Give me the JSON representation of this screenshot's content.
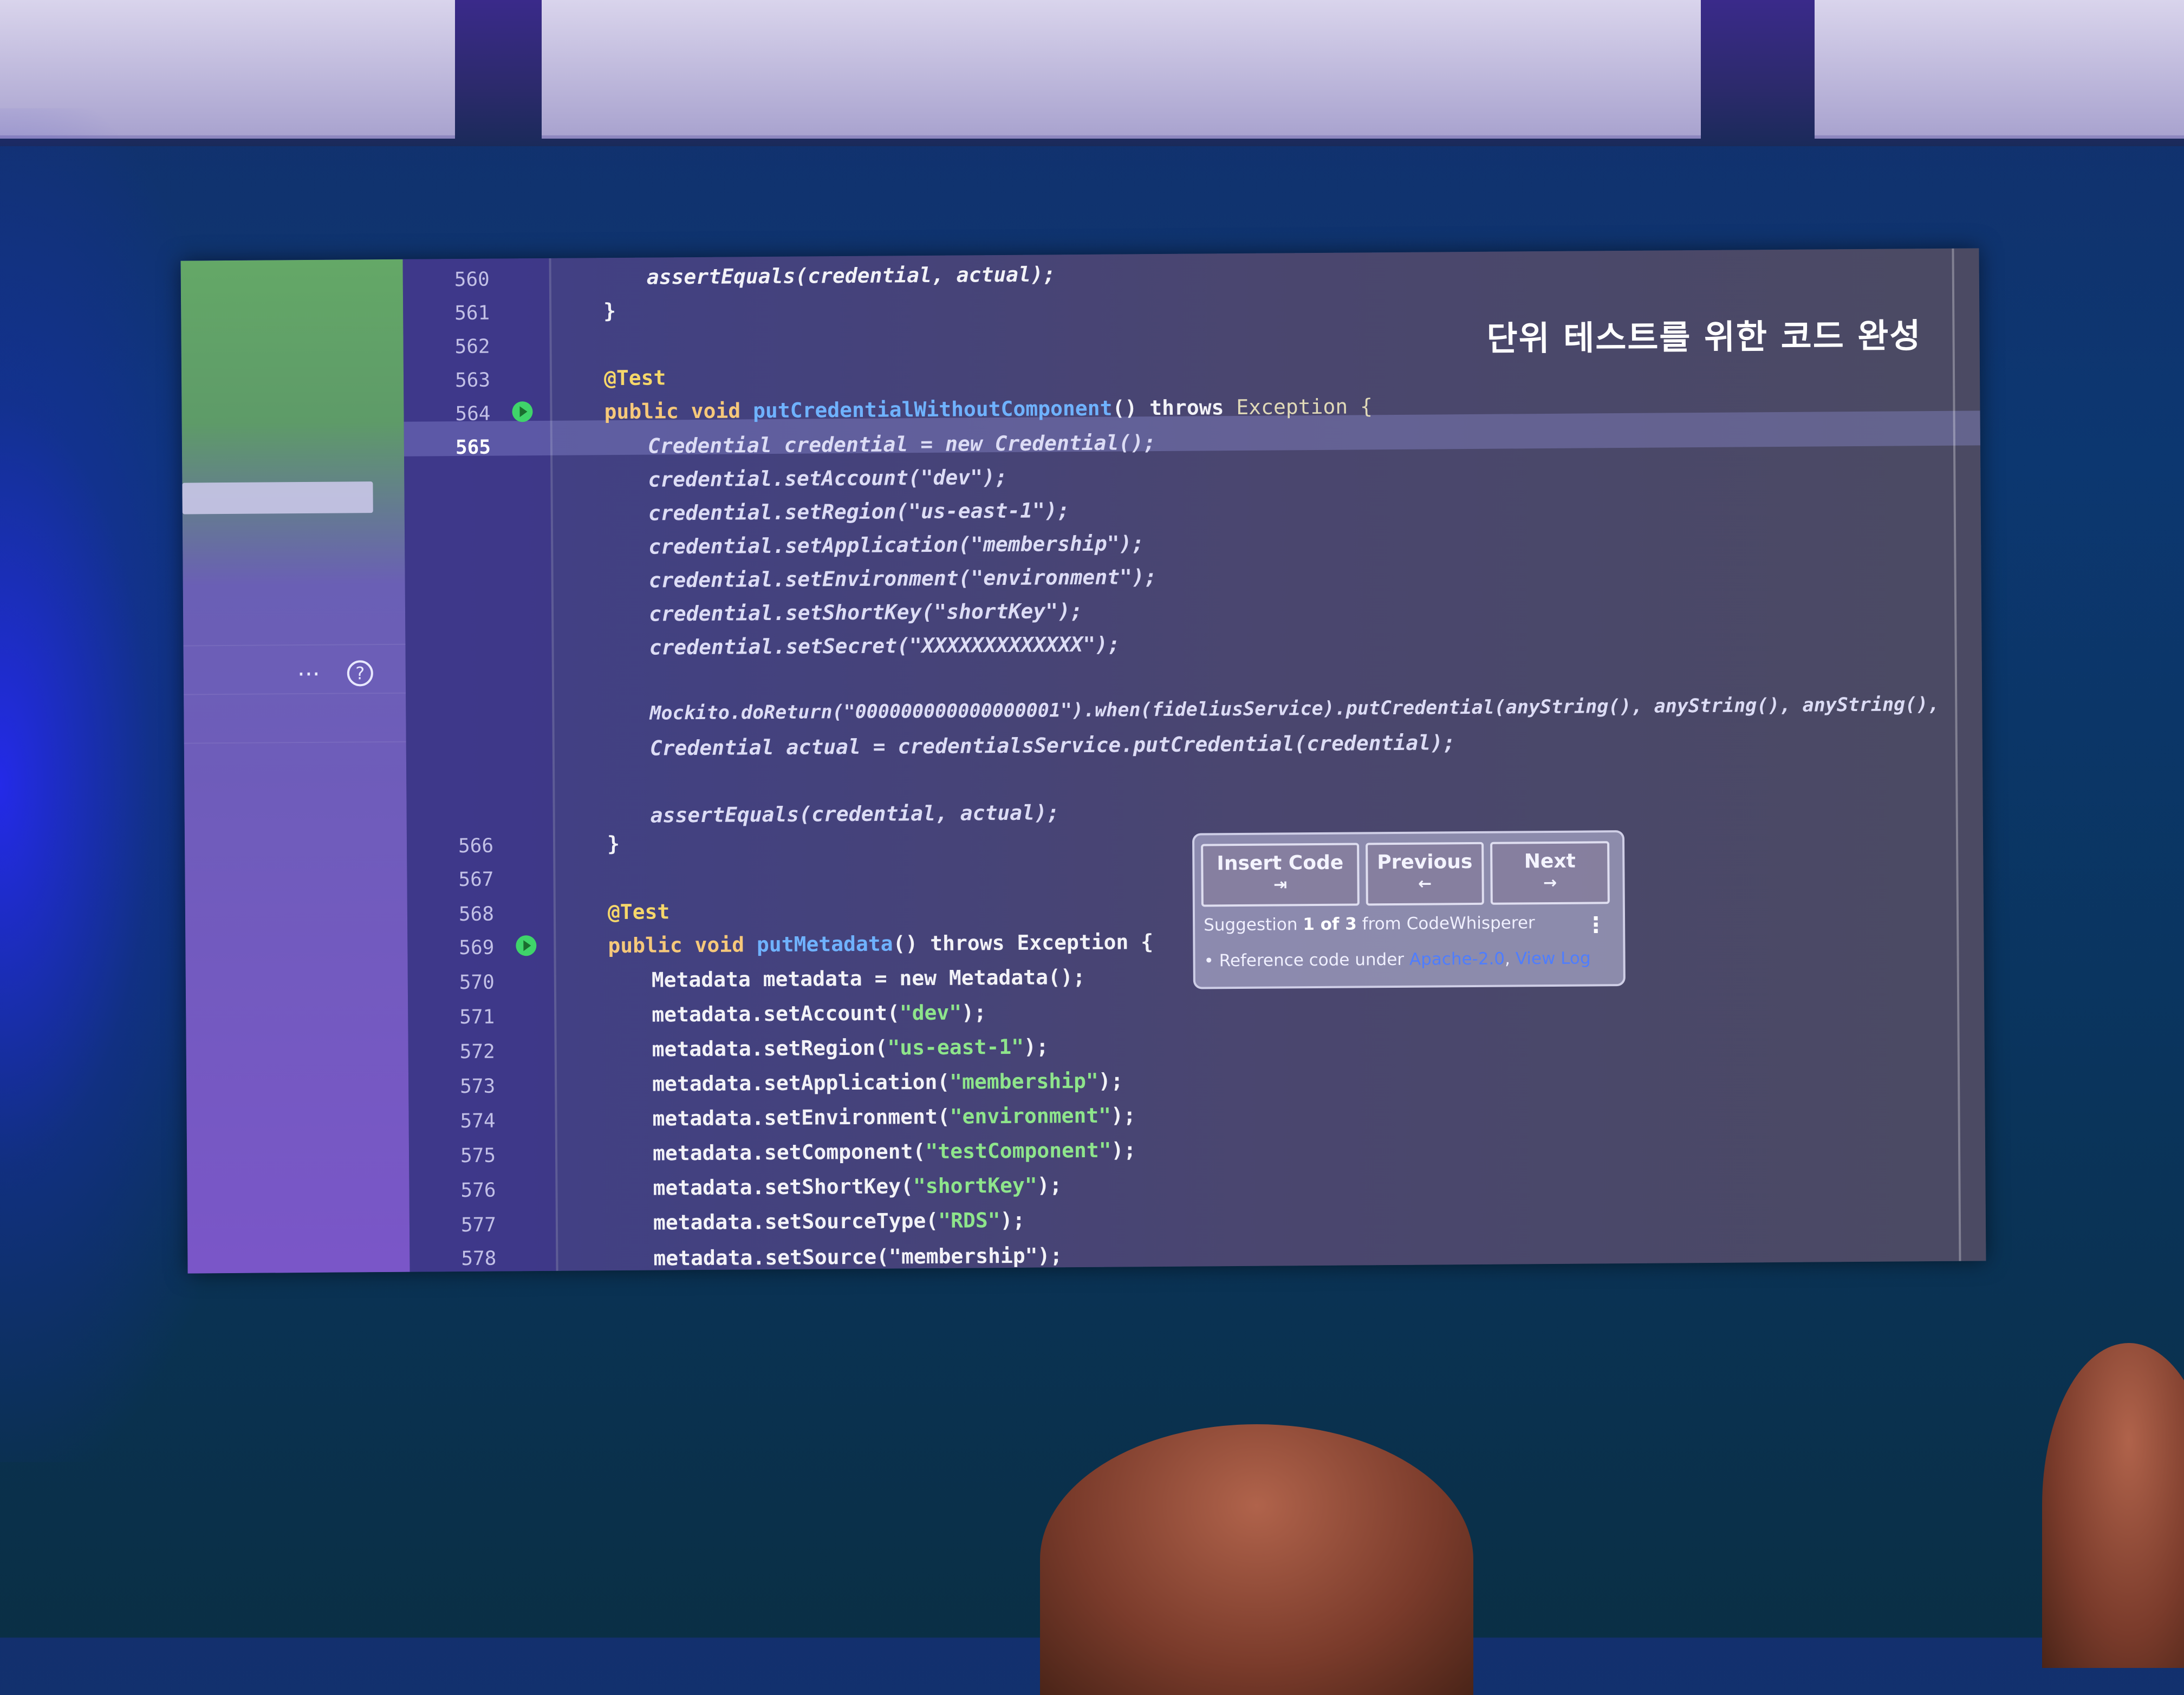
{
  "slide_title": "단위 테스트를 위한 코드 완성",
  "line_numbers": {
    "n560": "560",
    "n561": "561",
    "n562": "562",
    "n563": "563",
    "n564": "564",
    "n565": "565",
    "n566": "566",
    "n567": "567",
    "n568": "568",
    "n569": "569",
    "n570": "570",
    "n571": "571",
    "n572": "572",
    "n573": "573",
    "n574": "574",
    "n575": "575",
    "n576": "576",
    "n577": "577",
    "n578": "578"
  },
  "code": {
    "l560": "assertEquals(credential, actual);",
    "l561": "}",
    "l563": "@Test",
    "l564_kw": "public void",
    "l564_fn": "putCredentialWithoutComponent",
    "l564_rest": "() throws",
    "l564_exc": "Exception {",
    "g1": "Credential credential = new Credential();",
    "g2": "credential.setAccount(\"dev\");",
    "g3": "credential.setRegion(\"us-east-1\");",
    "g4": "credential.setApplication(\"membership\");",
    "g5": "credential.setEnvironment(\"environment\");",
    "g6": "credential.setShortKey(\"shortKey\");",
    "g7": "credential.setSecret(\"XXXXXXXXXXXXX\");",
    "g8": "Mockito.doReturn(\"000000000000000001\").when(fideliusService).putCredential(anyString(), anyString(), anyString(),",
    "g9": "Credential actual = credentialsService.putCredential(credential);",
    "g10": "assertEquals(credential, actual);",
    "l566": "}",
    "l568": "@Test",
    "l569_kw": "public void",
    "l569_fn": "putMetadata",
    "l569_rest": "() throws Exception {",
    "l570": "Metadata metadata = new Metadata();",
    "l571_a": "metadata.setAccount(",
    "l571_s": "\"dev\"",
    "l571_b": ");",
    "l572_a": "metadata.setRegion(",
    "l572_s": "\"us-east-1\"",
    "l572_b": ");",
    "l573_a": "metadata.setApplication(",
    "l573_s": "\"membership\"",
    "l573_b": ");",
    "l574_a": "metadata.setEnvironment(",
    "l574_s": "\"environment\"",
    "l574_b": ");",
    "l575_a": "metadata.setComponent(",
    "l575_s": "\"testComponent\"",
    "l575_b": ");",
    "l576_a": "metadata.setShortKey(",
    "l576_s": "\"shortKey\"",
    "l576_b": ");",
    "l577_a": "metadata.setSourceType(",
    "l577_s": "\"RDS\"",
    "l577_b": ");",
    "l578": "metadata.setSource(\"membership\");"
  },
  "suggestion_popup": {
    "insert_label": "Insert Code",
    "insert_key": "⇥",
    "previous_label": "Previous",
    "previous_arrow": "←",
    "next_label": "Next",
    "next_arrow": "→",
    "suggestion_prefix": "Suggestion",
    "suggestion_count": "1 of 3",
    "suggestion_suffix": "from CodeWhisperer",
    "reference_prefix": "• Reference code under",
    "license": "Apache-2.0",
    "view_log": "View Log",
    "more_glyph": "⋮"
  },
  "sidebar": {
    "more_glyph": "···",
    "help_glyph": "?"
  },
  "icons": [
    "run-test-icon",
    "more-options-icon",
    "help-icon"
  ],
  "colors": {
    "keyword": "#f6c87a",
    "function": "#6fb2ff",
    "string": "#8ee58b",
    "link": "#4e7dff"
  }
}
